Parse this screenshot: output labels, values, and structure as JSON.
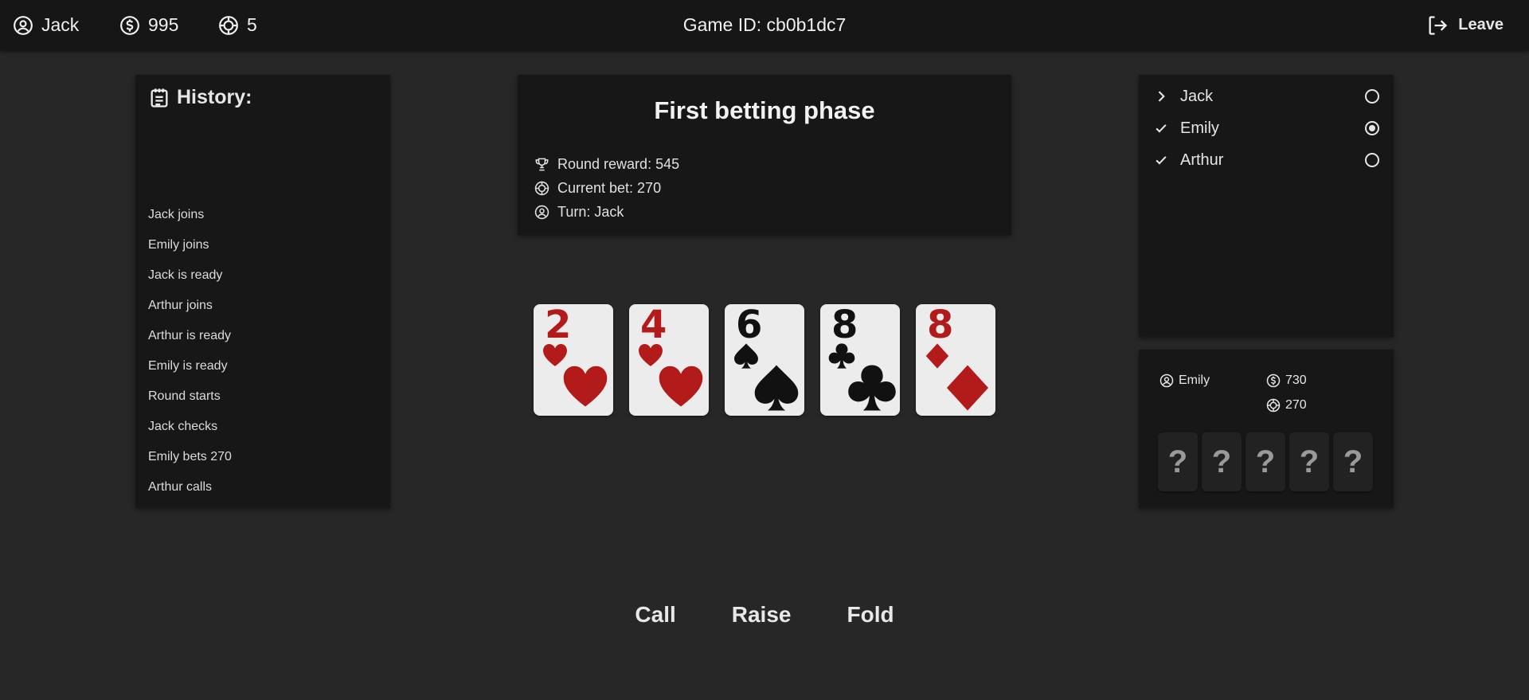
{
  "topbar": {
    "user": "Jack",
    "balance": "995",
    "chips": "5",
    "game_id": "Game ID: cb0b1dc7",
    "leave_label": "Leave",
    "icons": {
      "user": "user-circle-icon",
      "balance": "dollar-circle-icon",
      "chips": "poker-chip-icon",
      "leave": "logout-icon"
    }
  },
  "history": {
    "title": "History:",
    "items": [
      "Jack joins",
      "Emily joins",
      "Jack is ready",
      "Arthur joins",
      "Arthur is ready",
      "Emily is ready",
      "Round starts",
      "Jack checks",
      "Emily bets 270",
      "Arthur calls"
    ]
  },
  "phase": {
    "title": "First betting phase",
    "round_reward": "Round reward: 545",
    "current_bet": "Current bet: 270",
    "turn": "Turn: Jack"
  },
  "community_cards": [
    {
      "rank": "2",
      "suit": "hearts",
      "color": "red"
    },
    {
      "rank": "4",
      "suit": "hearts",
      "color": "red"
    },
    {
      "rank": "6",
      "suit": "spades",
      "color": "black"
    },
    {
      "rank": "8",
      "suit": "clubs",
      "color": "black"
    },
    {
      "rank": "8",
      "suit": "diamonds",
      "color": "red"
    }
  ],
  "players": [
    {
      "name": "Jack",
      "status": "current",
      "selected": false
    },
    {
      "name": "Emily",
      "status": "ready",
      "selected": true
    },
    {
      "name": "Arthur",
      "status": "ready",
      "selected": false
    }
  ],
  "opponent": {
    "name": "Emily",
    "balance": "730",
    "bet": "270",
    "hidden_cards": [
      "?",
      "?",
      "?",
      "?",
      "?"
    ]
  },
  "actions": {
    "call": "Call",
    "raise": "Raise",
    "fold": "Fold"
  },
  "colors": {
    "background": "#272727",
    "panel": "#171717",
    "topbar": "#161616",
    "red_suit": "#b31b1b"
  }
}
